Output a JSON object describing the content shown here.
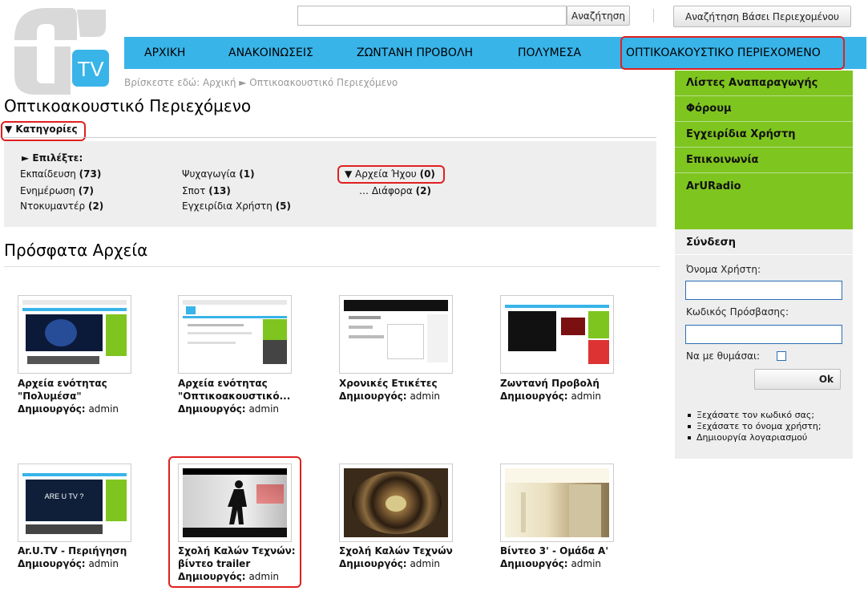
{
  "header": {
    "logo_text": "ArUTV",
    "search_placeholder": "",
    "search_button": "Αναζήτηση",
    "content_search_button": "Αναζήτηση Βάσει Περιεχομένου"
  },
  "nav": {
    "items": [
      "ΑΡΧΙΚΗ",
      "ΑΝΑΚΟΙΝΩΣΕΙΣ",
      "ΖΩΝΤΑΝΗ ΠΡΟΒΟΛΗ",
      "ΠΟΛΥΜΕΣΑ",
      "ΟΠΤΙΚΟΑΚΟΥΣΤΙΚΟ ΠΕΡΙΕΧΟΜΕΝΟ"
    ]
  },
  "breadcrumb": "Βρίσκεστε εδώ: Αρχική ► Οπτικοακουστικό Περιεχόμενο",
  "page_title": "Οπτικοακουστικό Περιεχόμενο",
  "categories": {
    "toggle": "▼ Κατηγορίες",
    "choose": "► Επιλέξτε:",
    "items": [
      {
        "name": "Εκπαίδευση",
        "count": "(73)"
      },
      {
        "name": "Ενημέρωση",
        "count": "(7)"
      },
      {
        "name": "Ντοκυμαντέρ",
        "count": "(2)"
      },
      {
        "name": "Ψυχαγωγία",
        "count": "(1)"
      },
      {
        "name": "Σποτ",
        "count": "(13)"
      },
      {
        "name": "Εγχειρίδια Χρήστη",
        "count": "(5)"
      },
      {
        "name": "▼ Αρχεία Ήχου",
        "count": "(0)"
      },
      {
        "name": "… Διάφορα",
        "count": "(2)"
      }
    ]
  },
  "recent": {
    "title": "Πρόσφατα Αρχεία",
    "creator_label": "Δημιουργός:",
    "items": [
      {
        "title1": "Αρχεία ενότητας",
        "title2": "\"Πολυμέσα\"",
        "author": "admin"
      },
      {
        "title1": "Αρχεία ενότητας",
        "title2": "\"Οπτικοακουστικό...",
        "author": "admin"
      },
      {
        "title1": "Χρονικές Ετικέτες",
        "title2": "",
        "author": "admin"
      },
      {
        "title1": "Ζωντανή Προβολή",
        "title2": "",
        "author": "admin"
      },
      {
        "title1": "Ar.U.TV - Περιήγηση",
        "title2": "",
        "author": "admin"
      },
      {
        "title1": "Σχολή Καλών Τεχνών:",
        "title2": "βίντεο trailer",
        "author": "admin"
      },
      {
        "title1": "Σχολή Καλών Τεχνών",
        "title2": "",
        "author": "admin"
      },
      {
        "title1": "Βίντεο 3' - Ομάδα Α'",
        "title2": "",
        "author": "admin"
      }
    ]
  },
  "sidebar": {
    "items": [
      "Λίστες Αναπαραγωγής",
      "Φόρουμ",
      "Εγχειρίδια Χρήστη",
      "Επικοινωνία",
      "ArURadio"
    ],
    "login": {
      "title": "Σύνδεση",
      "username_label": "Όνομα Χρήστη:",
      "password_label": "Κωδικός Πρόσβασης:",
      "remember_label": "Να με θυμάσαι:",
      "ok_button": "Ok",
      "links": [
        "Ξεχάσατε τον κωδικό σας;",
        "Ξεχάσατε το όνομα χρήστη;",
        "Δημιουργία λογαριασμού"
      ]
    }
  },
  "colors": {
    "nav": "#38b4e9",
    "sidebar": "#7fc51f",
    "highlight": "#e02020"
  }
}
